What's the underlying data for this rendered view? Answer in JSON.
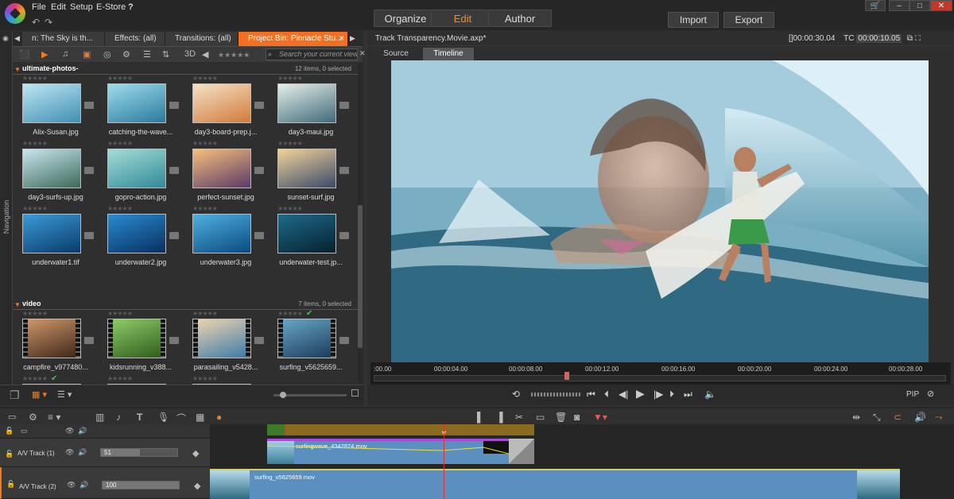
{
  "menu": {
    "file": "File",
    "edit": "Edit",
    "setup": "Setup",
    "estore": "E-Store",
    "help": "?"
  },
  "modes": {
    "organize": "Organize",
    "edit": "Edit",
    "author": "Author"
  },
  "actions": {
    "import": "Import",
    "export": "Export"
  },
  "window": {
    "cart": "🛒",
    "min": "–",
    "max": "□",
    "close": "✕"
  },
  "library": {
    "nav_label": "Navigation",
    "tabs": [
      {
        "label": "n: The Sky is th..."
      },
      {
        "label": "Effects: (all)"
      },
      {
        "label": "Transitions: (all)"
      },
      {
        "label": "Project Bin: Pinnacle Stu..."
      }
    ],
    "search_placeholder": "Search your current view",
    "toolbar_3d": "3D",
    "groups": [
      {
        "title": "ultimate-photos-",
        "count": "12 items, 0 selected",
        "items": [
          "Alix-Susan.jpg",
          "catching-the-wave...",
          "day3-board-prep.j...",
          "day3-maui.jpg",
          "day3-surfs-up.jpg",
          "gopro-action.jpg",
          "perfect-sunset.jpg",
          "sunset-surf.jpg",
          "underwater1.tif",
          "underwater2.jpg",
          "underwater3.jpg",
          "underwater-test.jp..."
        ]
      },
      {
        "title": "video",
        "count": "7 items, 0 selected",
        "items": [
          "campfire_v977480...",
          "kidsrunning_v388...",
          "parasailing_v5428...",
          "surfing_v5625659...",
          "",
          "",
          ""
        ]
      }
    ]
  },
  "preview": {
    "title": "Track Transparency.Movie.axp*",
    "duration": "[]00:00:30.04",
    "tc_label": "TC",
    "tc": "00:00:10.05",
    "tabs": {
      "source": "Source",
      "timeline": "Timeline"
    },
    "ruler": [
      ":00.00",
      "00:00:04.00",
      "00:00:08.00",
      "00:00:12.00",
      "00:00:16.00",
      "00:00:20.00",
      "00:00:24.00",
      "00:00:28.00"
    ],
    "pip": "PIP"
  },
  "timeline": {
    "tracks": [
      {
        "name": "A/V Track (1)",
        "volume": "51",
        "clip": "surfingwave_4342874.mov"
      },
      {
        "name": "A/V Track (2)",
        "volume": "100",
        "clip": "surfing_v5625659.mov"
      }
    ]
  },
  "colors": {
    "accent": "#f36f21",
    "edit_active": "#ff8a1c",
    "playhead": "#e03030",
    "clip_blue": "#5a8fc0",
    "title_clip": "#a74ad4"
  }
}
